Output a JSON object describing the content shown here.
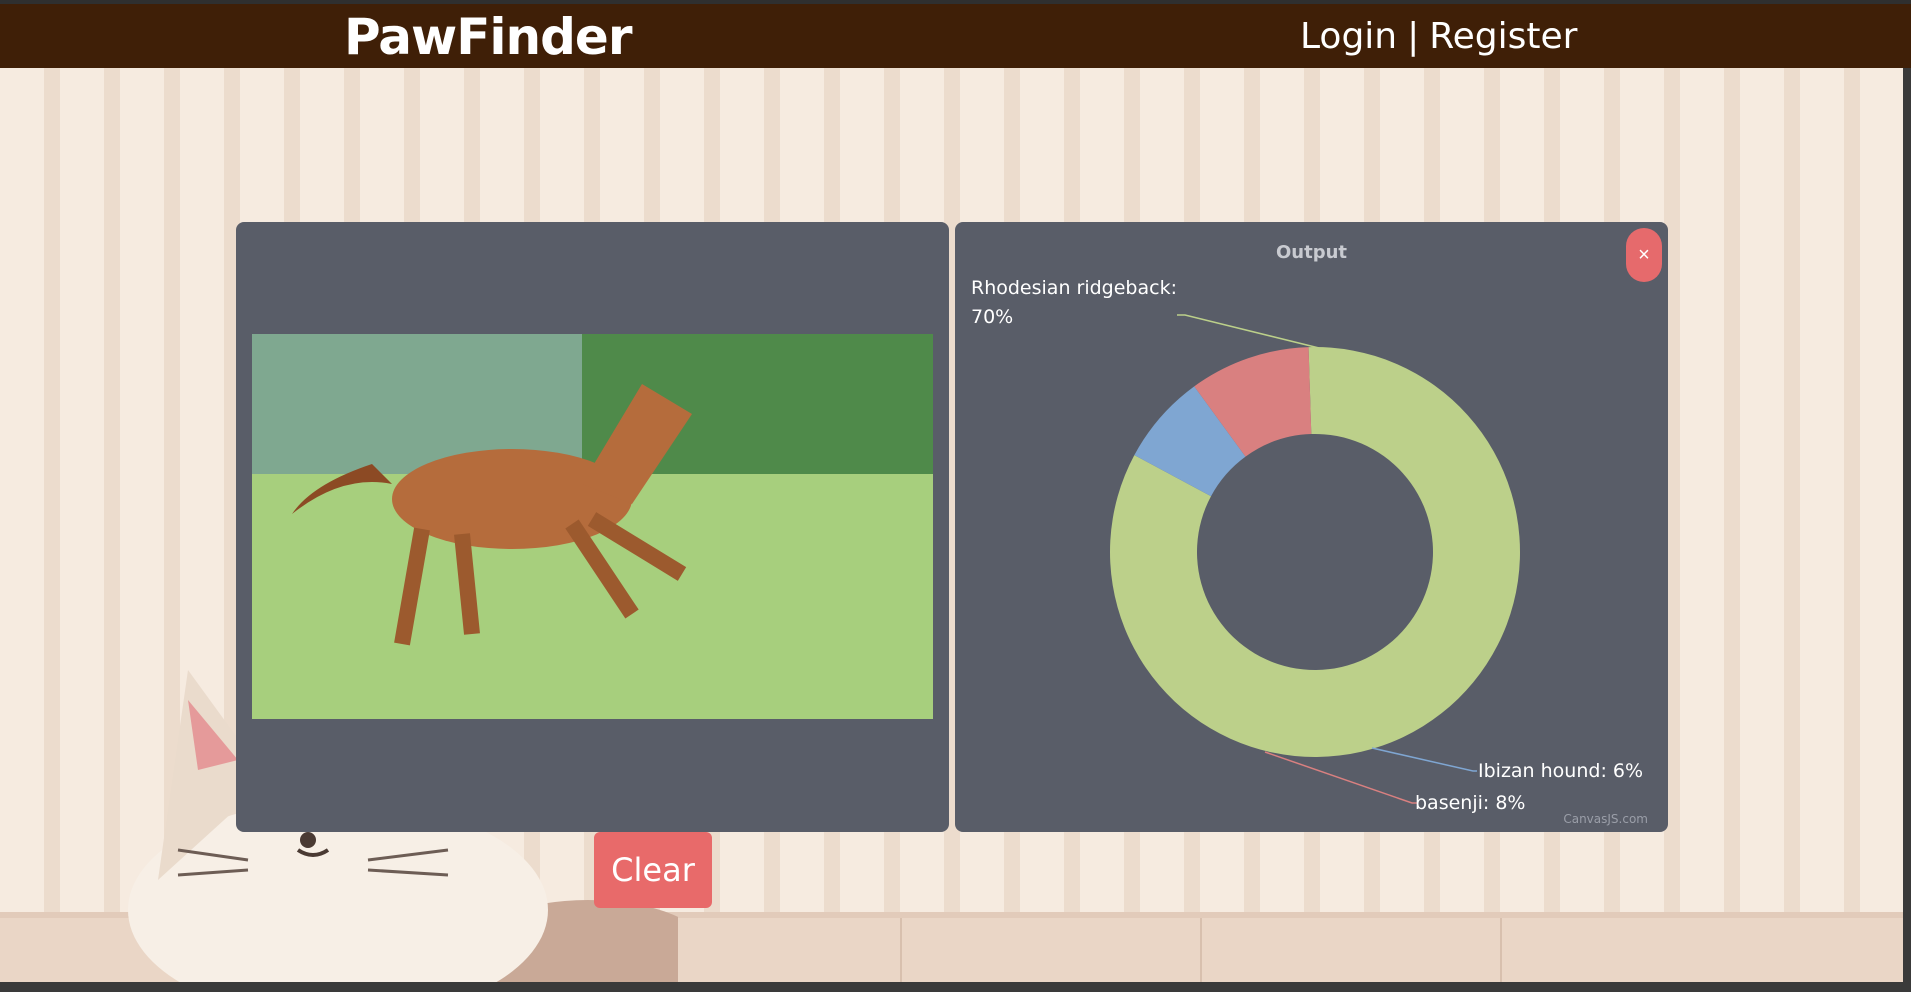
{
  "header": {
    "brand": "PawFinder",
    "login_label": "Login",
    "separator": "|",
    "register_label": "Register"
  },
  "upload": {
    "clear_label": "Clear"
  },
  "output": {
    "title": "Output",
    "close_label": "×",
    "credit": "CanvasJS.com"
  },
  "chart_data": {
    "type": "pie",
    "title": "Output",
    "variant": "doughnut",
    "labels": [
      "Rhodesian ridgeback",
      "Ibizan hound",
      "basenji"
    ],
    "values": [
      70,
      6,
      8
    ],
    "unit": "%",
    "colors": [
      "#bcd08a",
      "#7fa6d2",
      "#d98080"
    ],
    "label_texts": [
      "Rhodesian ridgeback:",
      "70%",
      "Ibizan hound: 6%",
      "basenji: 8%"
    ]
  },
  "colors": {
    "header_bg": "#3f1f07",
    "panel_bg": "#595d68",
    "clear_button": "#e86a6a",
    "close_button": "#e66a6c"
  }
}
